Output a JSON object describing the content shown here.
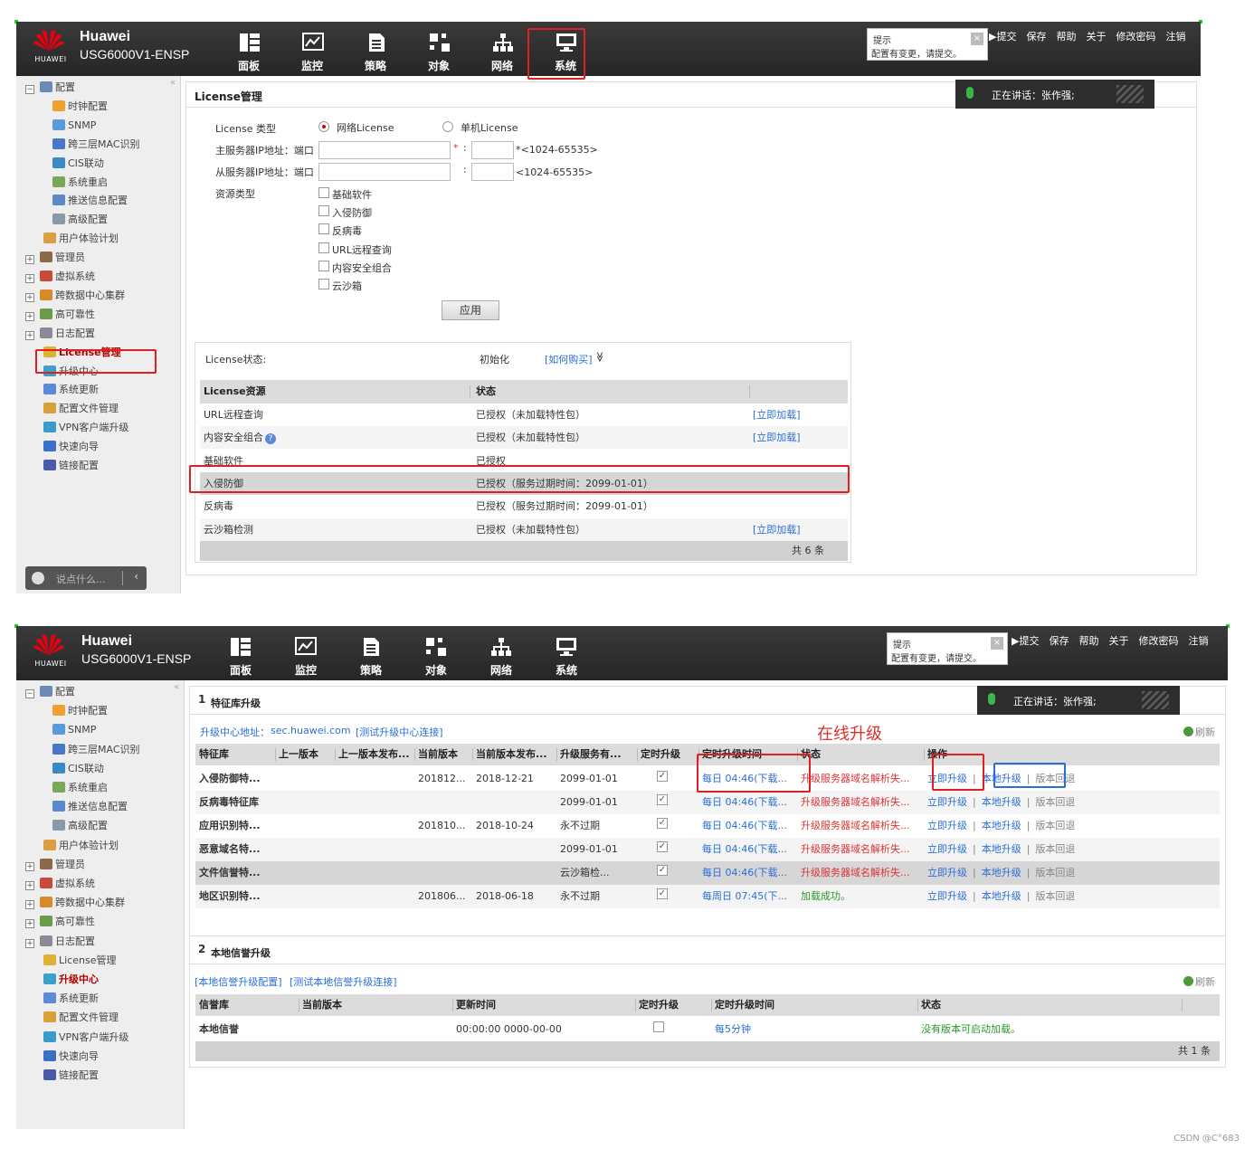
{
  "brand": {
    "name": "Huawei",
    "model": "USG6000V1-ENSP",
    "logo_text": "HUAWEI"
  },
  "nav": [
    {
      "label": "面板",
      "icon": "dashboard-icon"
    },
    {
      "label": "监控",
      "icon": "monitor-icon"
    },
    {
      "label": "策略",
      "icon": "policy-icon"
    },
    {
      "label": "对象",
      "icon": "object-icon"
    },
    {
      "label": "网络",
      "icon": "network-icon"
    },
    {
      "label": "系统",
      "icon": "system-icon"
    }
  ],
  "tip": {
    "title": "提示",
    "message": "配置有变更，请提交。",
    "close": "×"
  },
  "top_links": [
    "▶提交",
    "保存",
    "帮助",
    "关于",
    "修改密码",
    "注销"
  ],
  "voice": {
    "text": "正在讲话：张作强;"
  },
  "chat": {
    "placeholder": "说点什么...",
    "back": "‹"
  },
  "collapse": "«",
  "sidebar": {
    "items": [
      {
        "label": "配置",
        "level": 0,
        "expand": "−"
      },
      {
        "label": "时钟配置",
        "level": 2
      },
      {
        "label": "SNMP",
        "level": 2
      },
      {
        "label": "跨三层MAC识别",
        "level": 2
      },
      {
        "label": "CIS联动",
        "level": 2
      },
      {
        "label": "系统重启",
        "level": 2
      },
      {
        "label": "推送信息配置",
        "level": 2
      },
      {
        "label": "高级配置",
        "level": 2
      },
      {
        "label": "用户体验计划",
        "level": 1
      },
      {
        "label": "管理员",
        "level": 0,
        "expand": "+"
      },
      {
        "label": "虚拟系统",
        "level": 0,
        "expand": "+"
      },
      {
        "label": "跨数据中心集群",
        "level": 0,
        "expand": "+"
      },
      {
        "label": "高可靠性",
        "level": 0,
        "expand": "+"
      },
      {
        "label": "日志配置",
        "level": 0,
        "expand": "+"
      },
      {
        "label": "License管理",
        "level": 1
      },
      {
        "label": "升级中心",
        "level": 1
      },
      {
        "label": "系统更新",
        "level": 1
      },
      {
        "label": "配置文件管理",
        "level": 1
      },
      {
        "label": "VPN客户端升级",
        "level": 1
      },
      {
        "label": "快速向导",
        "level": 1
      },
      {
        "label": "链接配置",
        "level": 1
      }
    ]
  },
  "license": {
    "title": "License管理",
    "type_label": "License 类型",
    "radio_network": "网络License",
    "radio_single": "单机License",
    "primary_label": "主服务器IP地址：端口",
    "secondary_label": "从服务器IP地址：端口",
    "required_mark": "*",
    "colon": ":",
    "primary_port_hint": "*<1024-65535>",
    "secondary_port_hint": "<1024-65535>",
    "resource_label": "资源类型",
    "resources": [
      "基础软件",
      "入侵防御",
      "反病毒",
      "URL远程查询",
      "内容安全组合",
      "云沙箱"
    ],
    "apply": "应用",
    "status_label": "License状态:",
    "status_value": "初始化",
    "buy_link": "[如何购买]",
    "buy_arrow": "≫",
    "table_headers": [
      "License资源",
      "状态"
    ],
    "rows": [
      {
        "name": "URL远程查询",
        "status": "已授权（未加载特性包）",
        "action": "[立即加载]"
      },
      {
        "name": "内容安全组合",
        "status": "已授权（未加载特性包）",
        "action": "[立即加载]",
        "help": "?"
      },
      {
        "name": "基础软件",
        "status": "已授权",
        "action": ""
      },
      {
        "name": "入侵防御",
        "status": "已授权（服务过期时间：2099-01-01）",
        "action": ""
      },
      {
        "name": "反病毒",
        "status": "已授权（服务过期时间：2099-01-01）",
        "action": ""
      },
      {
        "name": "云沙箱检测",
        "status": "已授权（未加载特性包）",
        "action": "[立即加载]"
      }
    ],
    "total": "共 6 条"
  },
  "upgrade": {
    "sec1_num": "1",
    "sec1_title": "特征库升级",
    "center_label": "升级中心地址：",
    "center_addr": "sec.huawei.com",
    "test_link": "[测试升级中心连接]",
    "annotation": "在线升级",
    "refresh": "刷新",
    "headers": [
      "特征库",
      "上一版本",
      "上一版本发布...",
      "当前版本",
      "当前版本发布...",
      "升级服务有...",
      "定时升级",
      "定时升级时间",
      "状态",
      "操作"
    ],
    "rows": [
      {
        "name": "入侵防御特...",
        "prev": "",
        "prev_date": "",
        "cur": "201812...",
        "cur_date": "2018-12-21",
        "expire": "2099-01-01",
        "checked": "✓",
        "sched": "每日 04:46(下载...",
        "status": "升级服务器域名解析失...",
        "status_color": "red"
      },
      {
        "name": "反病毒特征库",
        "prev": "",
        "prev_date": "",
        "cur": "",
        "cur_date": "",
        "expire": "2099-01-01",
        "checked": "✓",
        "sched": "每日 04:46(下载...",
        "status": "升级服务器域名解析失...",
        "status_color": "red"
      },
      {
        "name": "应用识别特...",
        "prev": "",
        "prev_date": "",
        "cur": "201810...",
        "cur_date": "2018-10-24",
        "expire": "永不过期",
        "checked": "✓",
        "sched": "每日 04:46(下载...",
        "status": "升级服务器域名解析失...",
        "status_color": "red"
      },
      {
        "name": "恶意域名特...",
        "prev": "",
        "prev_date": "",
        "cur": "",
        "cur_date": "",
        "expire": "2099-01-01",
        "checked": "✓",
        "sched": "每日 04:46(下载...",
        "status": "升级服务器域名解析失...",
        "status_color": "red"
      },
      {
        "name": "文件信誉特...",
        "prev": "",
        "prev_date": "",
        "cur": "",
        "cur_date": "",
        "expire": "云沙箱检...",
        "checked": "✓",
        "sched": "每日 04:46(下载...",
        "status": "升级服务器域名解析失...",
        "status_color": "red"
      },
      {
        "name": "地区识别特...",
        "prev": "",
        "prev_date": "",
        "cur": "201806...",
        "cur_date": "2018-06-18",
        "expire": "永不过期",
        "checked": "✓",
        "sched": "每周日 07:45(下...",
        "status": "加载成功。",
        "status_color": "green"
      }
    ],
    "ops": {
      "upgrade_now": "立即升级",
      "local_upgrade": "本地升级",
      "rollback": "版本回退",
      "sep": "|"
    },
    "sec2_num": "2",
    "sec2_title": "本地信誉升级",
    "local_config_link": "[本地信誉升级配置]",
    "local_test_link": "[测试本地信誉升级连接]",
    "headers2": [
      "信誉库",
      "当前版本",
      "更新时间",
      "定时升级",
      "定时升级时间",
      "状态"
    ],
    "rows2": [
      {
        "name": "本地信誉",
        "cur": "",
        "time": "00:00:00 0000-00-00",
        "sched": "每5分钟",
        "status": "没有版本可启动加载。"
      }
    ],
    "total2": "共 1 条"
  },
  "watermark": "CSDN @C°683"
}
